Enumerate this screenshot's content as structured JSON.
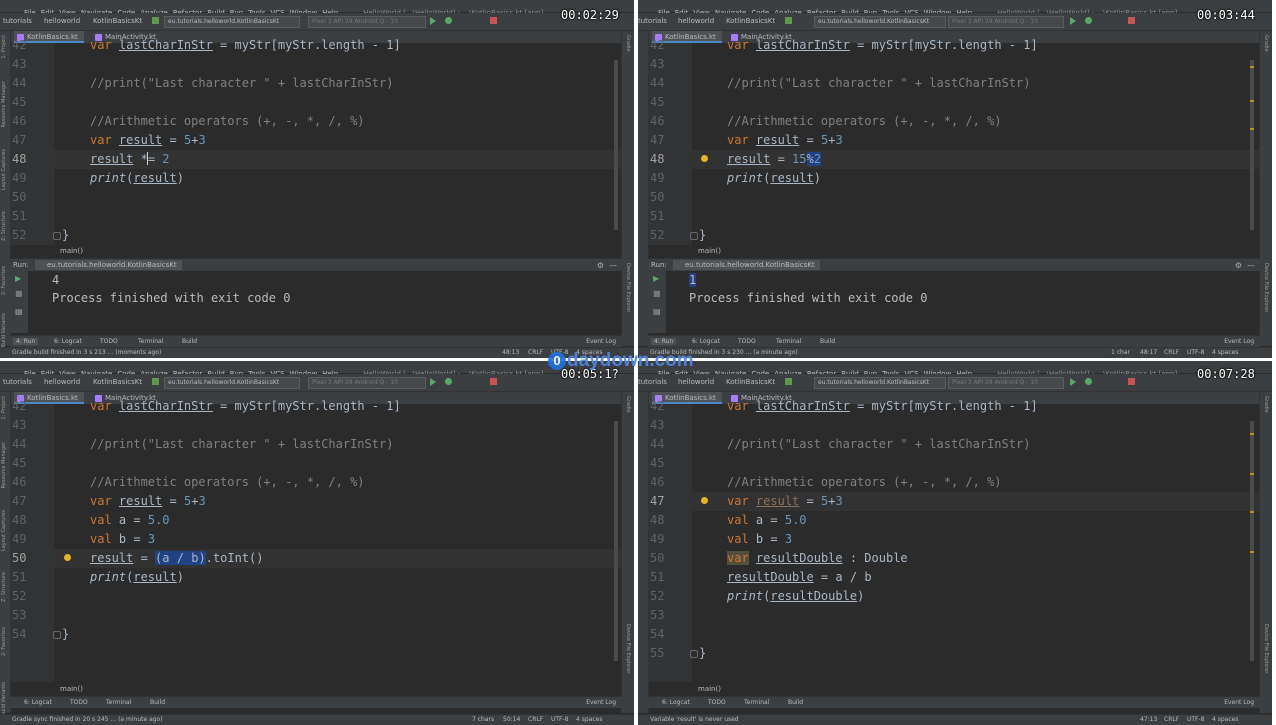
{
  "menu": [
    "File",
    "Edit",
    "View",
    "Navigate",
    "Code",
    "Analyze",
    "Refactor",
    "Build",
    "Run",
    "Tools",
    "VCS",
    "Window",
    "Help"
  ],
  "window_title": "HelloWorld [...\\HelloWorld] - ...\\KotlinBasics.kt [app]",
  "nav": {
    "crumb_project": "tutorials",
    "crumb_module": "helloworld",
    "crumb_file": "KotlinBasicsKt",
    "run_config": "eu.tutorials.helloworld.KotlinBasicsKt",
    "device": "Pixel 3 API 29 Android Q - 10"
  },
  "tabs": [
    "KotlinBasics.kt",
    "MainActivity.kt"
  ],
  "left_tools": [
    "1: Project",
    "Resource Manager",
    "Layout Captures",
    "Z: Structure",
    "2: Favorites",
    "Build Variants"
  ],
  "right_tools": [
    "Gradle",
    "Device File Explorer"
  ],
  "bottom_tools": [
    "4: Run",
    "6: Logcat",
    "TODO",
    "Terminal",
    "Build"
  ],
  "event_log": "Event Log",
  "icons": [
    "play-icon",
    "debug-icon",
    "stop-icon",
    "gear-icon",
    "minimize-icon",
    "lightbulb-icon",
    "hammer-icon"
  ],
  "colors": {
    "keyword": "#cc7832",
    "number": "#6897bb",
    "comment": "#808080",
    "text": "#a9b7c6",
    "selection": "#214283"
  },
  "panes": [
    {
      "timer": "00:02:29",
      "lines": [
        "42",
        "43",
        "44",
        "45",
        "46",
        "47",
        "48",
        "49",
        "50",
        "51",
        "52"
      ],
      "current_line": "48",
      "breadcrumb": "main()",
      "run_label": "Run:",
      "run_tab": "eu.tutorials.helloworld.KotlinBasicsKt",
      "output": [
        "4",
        "Process finished with exit code 0"
      ],
      "status_left": "Gradle build finished in 3 s 213 ... (moments ago)",
      "status_pos": "48:13",
      "status_crlf": "CRLF",
      "status_enc": "UTF-8",
      "status_indent": "4 spaces"
    },
    {
      "timer": "00:03:44",
      "lines": [
        "42",
        "43",
        "44",
        "45",
        "46",
        "47",
        "48",
        "49",
        "50",
        "51",
        "52"
      ],
      "current_line": "48",
      "breadcrumb": "main()",
      "run_label": "Run:",
      "run_tab": "eu.tutorials.helloworld.KotlinBasicsKt",
      "output": [
        "1",
        "Process finished with exit code 0"
      ],
      "status_left": "Gradle build finished in 3 s 230 ... (a minute ago)",
      "status_chars": "1 char",
      "status_pos": "48:17",
      "status_crlf": "CRLF",
      "status_enc": "UTF-8",
      "status_indent": "4 spaces"
    },
    {
      "timer": "00:05:1?",
      "lines": [
        "42",
        "43",
        "44",
        "45",
        "46",
        "47",
        "48",
        "49",
        "50",
        "51",
        "52",
        "53",
        "54"
      ],
      "current_line": "50",
      "breadcrumb": "main()",
      "status_left": "Gradle sync finished in 20 s 245 ... (a minute ago)",
      "status_chars": "7 chars",
      "status_pos": "50:14",
      "status_crlf": "CRLF",
      "status_enc": "UTF-8",
      "status_indent": "4 spaces"
    },
    {
      "timer": "00:07:28",
      "lines": [
        "42",
        "43",
        "44",
        "45",
        "46",
        "47",
        "48",
        "49",
        "50",
        "51",
        "52",
        "53",
        "54",
        "55"
      ],
      "current_line": "47",
      "breadcrumb": "main()",
      "status_left": "Variable 'result' is never used",
      "status_pos": "47:13",
      "status_crlf": "CRLF",
      "status_enc": "UTF-8",
      "status_indent": "4 spaces"
    }
  ],
  "code": {
    "l42a": "var ",
    "l42b": "lastCharInStr",
    "l42c": " = myStr[myStr.length - 1]",
    "l44": "//print(\"Last character \" + lastCharInStr)",
    "l46": "//Arithmetic operators (+, -, *, /, %)",
    "var": "var",
    "val": "val",
    "result": "result",
    "print": "print",
    "n5": "5",
    "n3": "3",
    "n2": "2",
    "n50": "5.0",
    "n15": "15",
    "pct": "%",
    "a": "a",
    "b": "b",
    "resultDouble": "resultDouble",
    "typeDouble": ": Double",
    "toInt": ".toInt()",
    "close": "}"
  },
  "watermark": "daydown.com"
}
